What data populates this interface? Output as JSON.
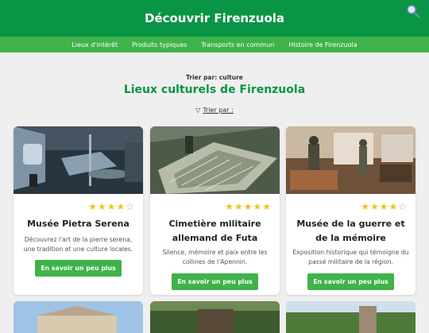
{
  "header": {
    "title": "Découvrir Firenzuola"
  },
  "nav": {
    "items": [
      "Lieux d'intérêt",
      "Produits typiques",
      "Transports en commun",
      "Histoire de Firenzuola"
    ]
  },
  "sort": {
    "caption": "Trier par: culture",
    "toggle_label": "Trier par :"
  },
  "main": {
    "title": "Lieux culturels de Firenzuola"
  },
  "cards": [
    {
      "title": "Musée Pietra Serena",
      "rating": 4,
      "description": "Découvrez l'art de la pierre serena, une tradition et une culture locales.",
      "button": "En savoir un peu plus"
    },
    {
      "title": "Cimetière militaire allemand de Futa",
      "rating": 5,
      "description": "Silence, mémoire et paix entre les collines de l'Apennin.",
      "button": "En savoir un peu plus"
    },
    {
      "title": "Musée de la guerre et de la mémoire",
      "rating": 4,
      "description": "Exposition historique qui témoigne du passé militaire de la région.",
      "button": "En savoir un peu plus"
    }
  ],
  "icons": {
    "search": "search-icon",
    "sort": "triangle-down-icon",
    "star": "star-icon"
  },
  "colors": {
    "primary": "#0a9445",
    "nav": "#3fb34a",
    "star": "#f0c419",
    "background": "#efefef"
  }
}
